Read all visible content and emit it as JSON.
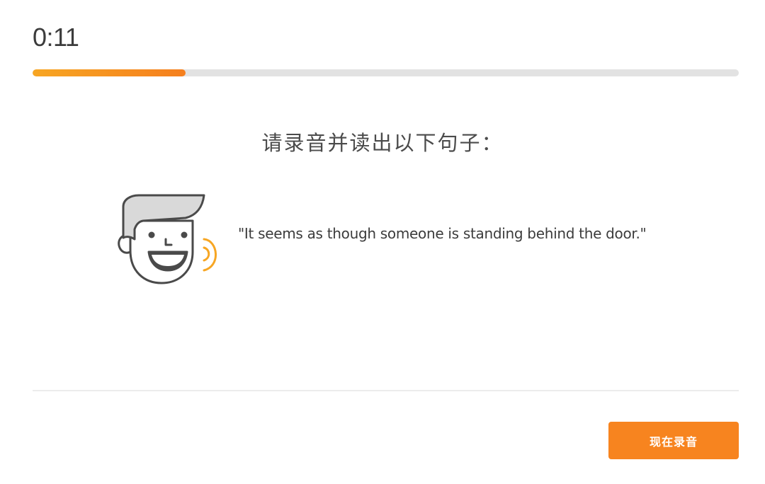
{
  "timer": {
    "text": "0:11"
  },
  "progress": {
    "value_percent": 21.7,
    "colors": [
      "#f7a623",
      "#f57f1e"
    ]
  },
  "prompt": {
    "text": "请录音并读出以下句子："
  },
  "speaker": {
    "icon": "speaking-face-icon",
    "accent_color": "#f7a623"
  },
  "sentence": {
    "text": "\"It seems as though someone is standing behind the door.\""
  },
  "footer": {
    "record_button_label": "现在录音",
    "record_button_color": "#f7841f"
  }
}
